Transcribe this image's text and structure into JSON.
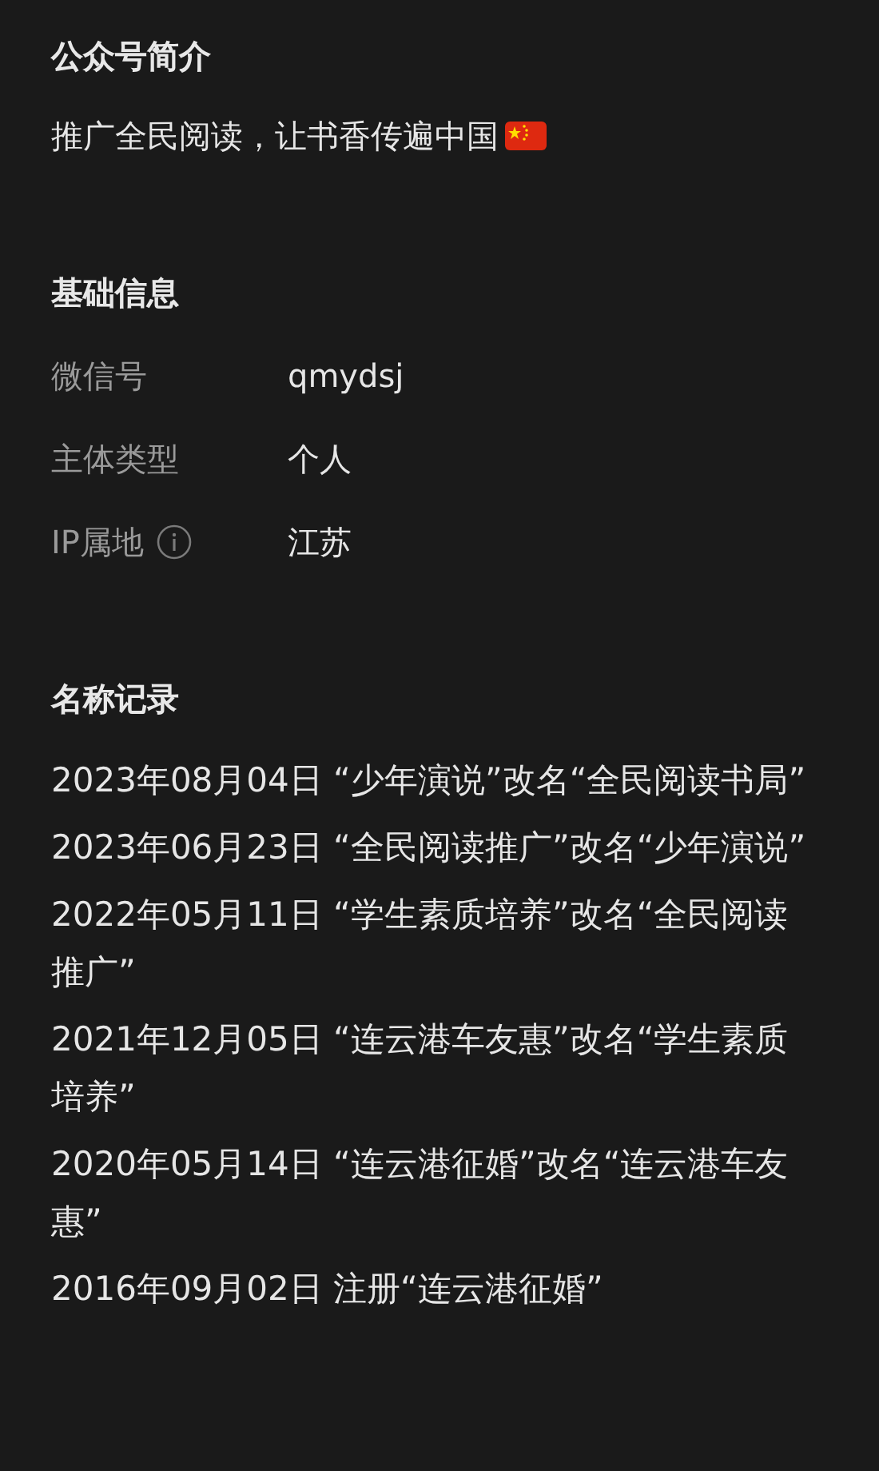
{
  "intro": {
    "heading": "公众号简介",
    "text": "推广全民阅读，让书香传遍中国"
  },
  "basic_info": {
    "heading": "基础信息",
    "rows": [
      {
        "label": "微信号",
        "value": "qmydsj",
        "info_icon": false
      },
      {
        "label": "主体类型",
        "value": "个人",
        "info_icon": false
      },
      {
        "label": "IP属地",
        "value": "江苏",
        "info_icon": true
      }
    ]
  },
  "name_history": {
    "heading": "名称记录",
    "records": [
      "2023年08月04日 “少年演说”改名“全民阅读书局”",
      "2023年06月23日 “全民阅读推广”改名“少年演说”",
      "2022年05月11日 “学生素质培养”改名“全民阅读推广”",
      "2021年12月05日 “连云港车友惠”改名“学生素质培养”",
      "2020年05月14日 “连云港征婚”改名“连云港车友惠”",
      "2016年09月02日 注册“连云港征婚”"
    ]
  }
}
